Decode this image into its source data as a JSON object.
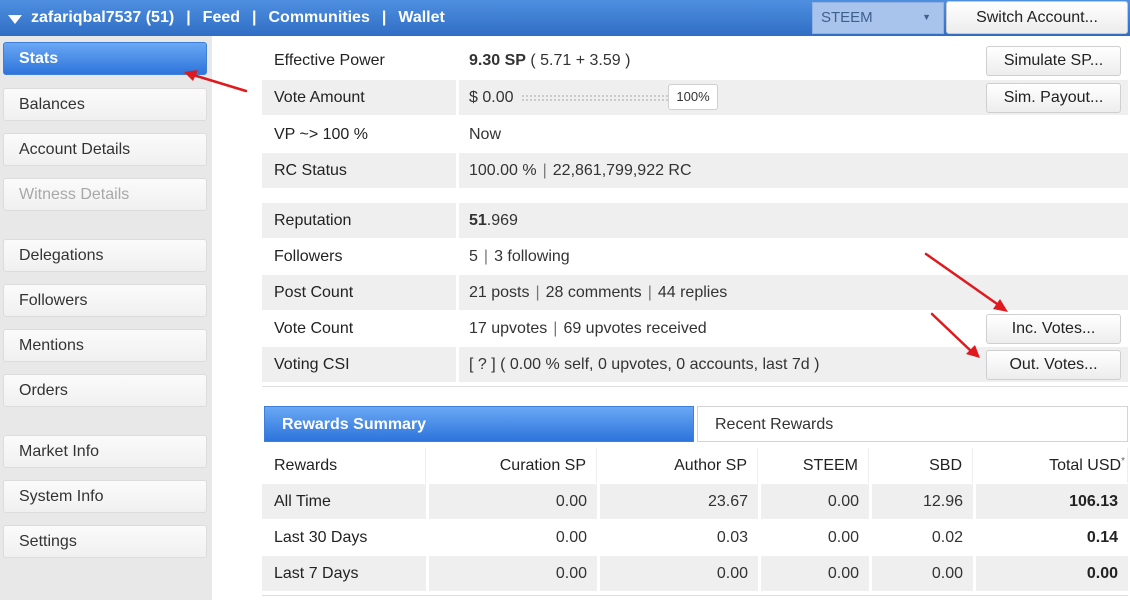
{
  "topbar": {
    "account": "zafariqbal7537 (51)",
    "sep": "|",
    "links": [
      "Feed",
      "Communities",
      "Wallet"
    ],
    "chain": "STEEM",
    "switch_label": "Switch Account..."
  },
  "sidebar": {
    "items": [
      {
        "label": "Stats",
        "state": "active"
      },
      {
        "label": "Balances",
        "state": "normal"
      },
      {
        "label": "Account Details",
        "state": "normal"
      },
      {
        "label": "Witness Details",
        "state": "disabled"
      },
      {
        "label": "Delegations",
        "state": "normal"
      },
      {
        "label": "Followers",
        "state": "normal"
      },
      {
        "label": "Mentions",
        "state": "normal"
      },
      {
        "label": "Orders",
        "state": "normal"
      },
      {
        "label": "Market Info",
        "state": "normal"
      },
      {
        "label": "System Info",
        "state": "normal"
      },
      {
        "label": "Settings",
        "state": "normal"
      }
    ]
  },
  "stats": {
    "effective_power": {
      "label": "Effective Power",
      "value_bold": "9.30 SP",
      "value_rest": " ( 5.71 + 3.59 )",
      "button": "Simulate SP..."
    },
    "vote_amount": {
      "label": "Vote Amount",
      "value": "$ 0.00",
      "slider_value": "100%",
      "button": "Sim. Payout..."
    },
    "vp": {
      "label": "VP ~> 100 %",
      "value": "Now"
    },
    "rc_status": {
      "label": "RC Status",
      "value_a": "100.00 %",
      "value_b": "22,861,799,922 RC"
    },
    "reputation": {
      "label": "Reputation",
      "value_bold": "51",
      "value_rest": ".969"
    },
    "followers": {
      "label": "Followers",
      "value_a": "5",
      "value_b": "3 following"
    },
    "post_count": {
      "label": "Post Count",
      "value_a": "21 posts",
      "value_b": "28 comments",
      "value_c": "44 replies"
    },
    "vote_count": {
      "label": "Vote Count",
      "value_a": "17 upvotes",
      "value_b": "69 upvotes received",
      "button": "Inc. Votes..."
    },
    "voting_csi": {
      "label": "Voting CSI",
      "value": "[ ? ] ( 0.00 % self, 0 upvotes, 0 accounts, last 7d )",
      "button": "Out. Votes..."
    },
    "pipe": "|"
  },
  "rewards": {
    "tabs": [
      "Rewards Summary",
      "Recent Rewards"
    ],
    "headers": [
      "Rewards",
      "Curation SP",
      "Author SP",
      "STEEM",
      "SBD",
      "Total USD"
    ],
    "header_mark": "*",
    "rows": [
      {
        "name": "All Time",
        "curation": "0.00",
        "author": "23.67",
        "steem": "0.00",
        "sbd": "12.96",
        "total": "106.13"
      },
      {
        "name": "Last 30 Days",
        "curation": "0.00",
        "author": "0.03",
        "steem": "0.00",
        "sbd": "0.02",
        "total": "0.14"
      },
      {
        "name": "Last 7 Days",
        "curation": "0.00",
        "author": "0.00",
        "steem": "0.00",
        "sbd": "0.00",
        "total": "0.00"
      }
    ]
  },
  "colors": {
    "accent": "#2f6ec4",
    "annotation_arrow": "#e0191e"
  }
}
